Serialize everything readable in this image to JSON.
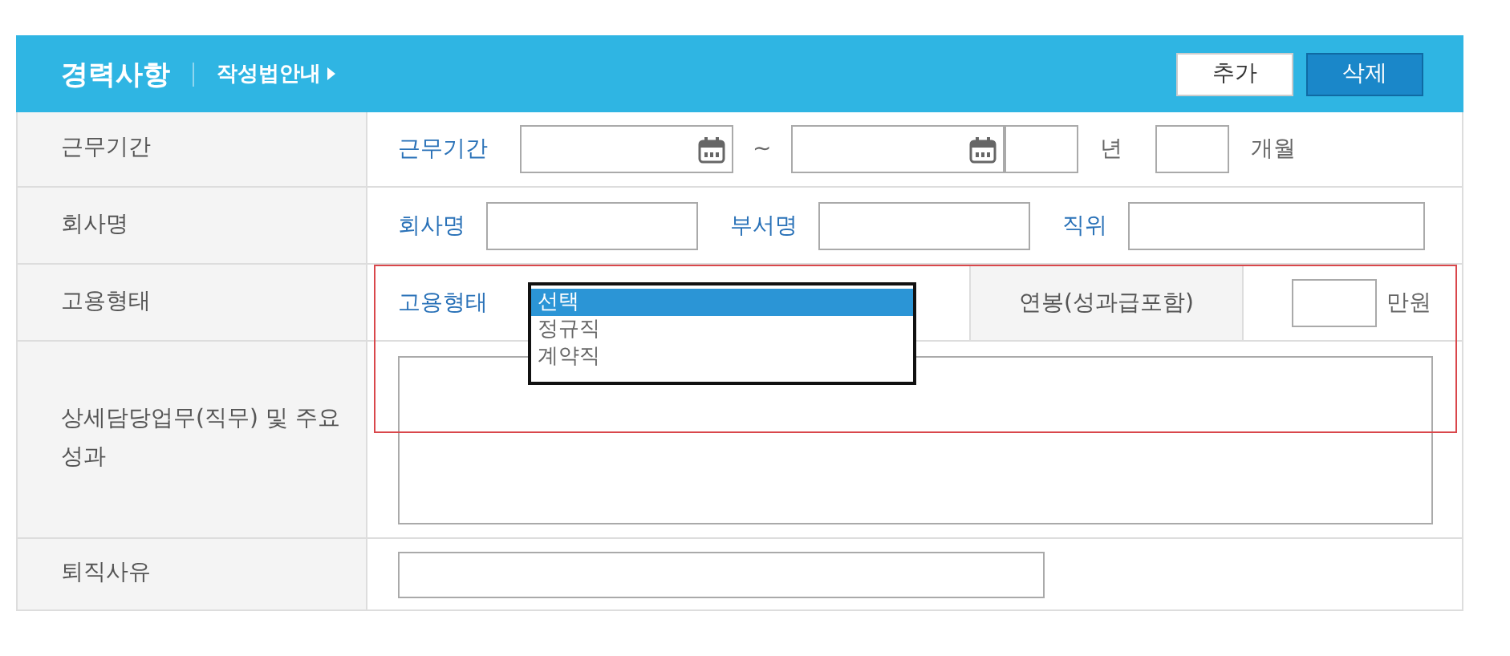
{
  "header": {
    "title": "경력사항",
    "guide_link": "작성법안내",
    "buttons": [
      {
        "label": "추가",
        "kind": "secondary"
      },
      {
        "label": "삭제",
        "kind": "primary"
      }
    ]
  },
  "rows": [
    {
      "kind": "period",
      "label": "근무기간",
      "field_label": "근무기간",
      "separator": "~",
      "year_unit": "년",
      "month_unit": "개월"
    },
    {
      "kind": "company",
      "label": "회사명",
      "fields": [
        {
          "label": "회사명"
        },
        {
          "label": "부서명"
        },
        {
          "label": "직위"
        }
      ]
    },
    {
      "kind": "employment",
      "label": "고용형태",
      "field_label": "고용형태",
      "highlighted": true,
      "options": [
        {
          "text": "선택",
          "selected": true
        },
        {
          "text": "정규직",
          "selected": false
        },
        {
          "text": "계약직",
          "selected": false
        }
      ],
      "salary_label": "연봉(성과급포함)",
      "salary_unit": "만원"
    },
    {
      "kind": "textarea",
      "label": "상세담당업무(직무) 및 주요성과"
    },
    {
      "kind": "text",
      "label": "퇴직사유"
    }
  ]
}
